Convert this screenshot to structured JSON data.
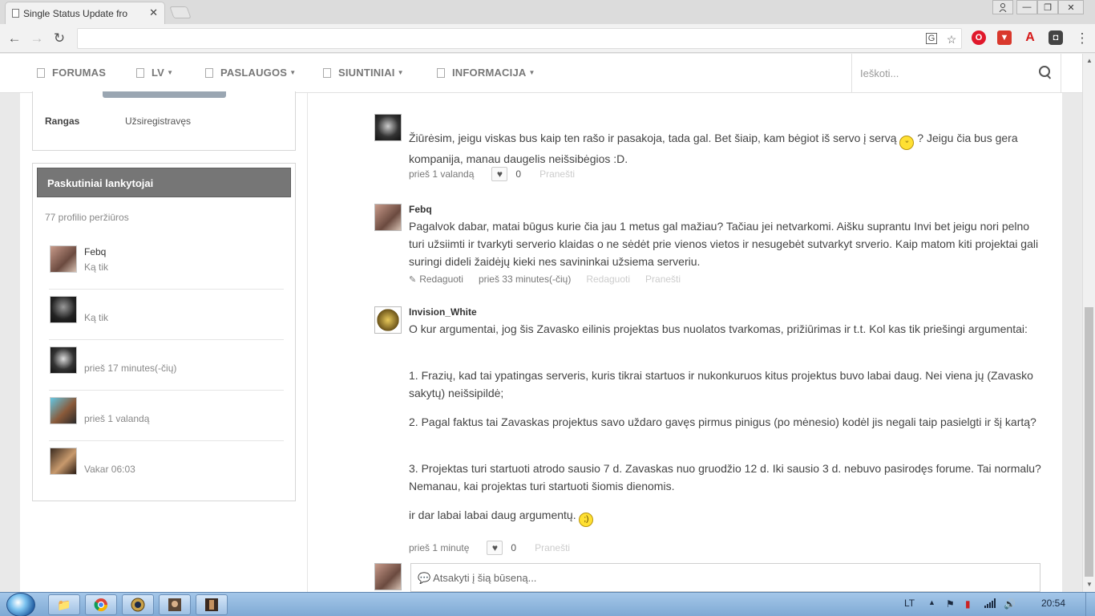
{
  "browser": {
    "tab_title": "Single Status Update fro",
    "tab_close": "✕",
    "win_min": "—",
    "win_max": "❐",
    "win_close": "✕",
    "user_icon": "user-icon",
    "back": "←",
    "forward": "→",
    "reload": "↻",
    "menu": "⋮"
  },
  "nav": {
    "items": [
      {
        "label": "FORUMAS",
        "dropdown": false
      },
      {
        "label": "LV",
        "dropdown": true
      },
      {
        "label": "PASLAUGOS",
        "dropdown": true
      },
      {
        "label": "SIUNTINIAI",
        "dropdown": true
      },
      {
        "label": "INFORMACIJA",
        "dropdown": true
      }
    ],
    "search_placeholder": "Ieškoti..."
  },
  "profile": {
    "rank_label": "Rangas",
    "rank_value": "Užsiregistravęs"
  },
  "visitors": {
    "title": "Paskutiniai lankytojai",
    "views": "77 profilio peržiūros",
    "items": [
      {
        "name": "Febq",
        "time": "Ką tik"
      },
      {
        "name": "",
        "time": "Ką tik"
      },
      {
        "name": "",
        "time": "prieš 17 minutes(-čių)"
      },
      {
        "name": "",
        "time": "prieš 1 valandą"
      },
      {
        "name": "",
        "time": "Vakar 06:03"
      }
    ]
  },
  "posts": [
    {
      "author": "",
      "text_before_emoji": "Žiūrėsim, jeigu viskas bus kaip ten rašo ir pasakoja, tada gal. Bet šiaip, kam bėgiot iš servo į servą",
      "text_after_emoji": " ? Jeigu čia bus gera kompanija, manau daugelis neišsibėgios :D.",
      "time": "prieš 1 valandą",
      "likes": "0",
      "report": "Pranešti"
    },
    {
      "author": "Febq",
      "text": "Pagalvok dabar, matai būgus kurie čia jau 1 metus gal mažiau? Tačiau jei netvarkomi. Aišku suprantu Invi bet jeigu nori pelno turi užsiimti ir tvarkyti serverio klaidas o ne sėdėt prie vienos vietos ir nesugebėt sutvarkyt srverio. Kaip matom kiti projektai gali suringi dideli žaidėjų kieki nes savininkai užsiema serveriu.",
      "edit": "Redaguoti",
      "time": "prieš 33 minutes(-čių)",
      "edit2": "Redaguoti",
      "report": "Pranešti"
    },
    {
      "author": "Invision_White",
      "paragraphs": [
        "O kur argumentai, jog šis Zavasko eilinis projektas bus nuolatos tvarkomas, prižiūrimas ir t.t. Kol kas tik priešingi argumentai:",
        "1. Frazių, kad tai ypatingas serveris, kuris tikrai startuos ir nukonkuruos kitus projektus buvo labai daug. Nei viena jų (Zavasko sakytų) neišsipildė;",
        "2. Pagal faktus tai Zavaskas projektus savo uždaro gavęs pirmus pinigus (po mėnesio) kodėl jis negali taip pasielgti ir šį kartą?",
        "3. Projektas turi startuoti atrodo sausio 7 d. Zavaskas nuo gruodžio 12 d. Iki sausio 3 d. nebuvo pasirodęs forume. Tai normalu? Nemanau, kai projektas turi startuoti šiomis dienomis."
      ],
      "last_paragraph": "ir dar labai labai daug argumentų.",
      "time": "prieš 1 minutę",
      "likes": "0",
      "report": "Pranešti"
    }
  ],
  "reply": {
    "placeholder": "💬 Atsakyti į šią būseną..."
  },
  "taskbar": {
    "lang": "LT",
    "clock": "20:54"
  },
  "colors": {
    "accent_header": "#767676",
    "link_muted": "#cccccc",
    "page_bg": "#e9e9e9"
  }
}
